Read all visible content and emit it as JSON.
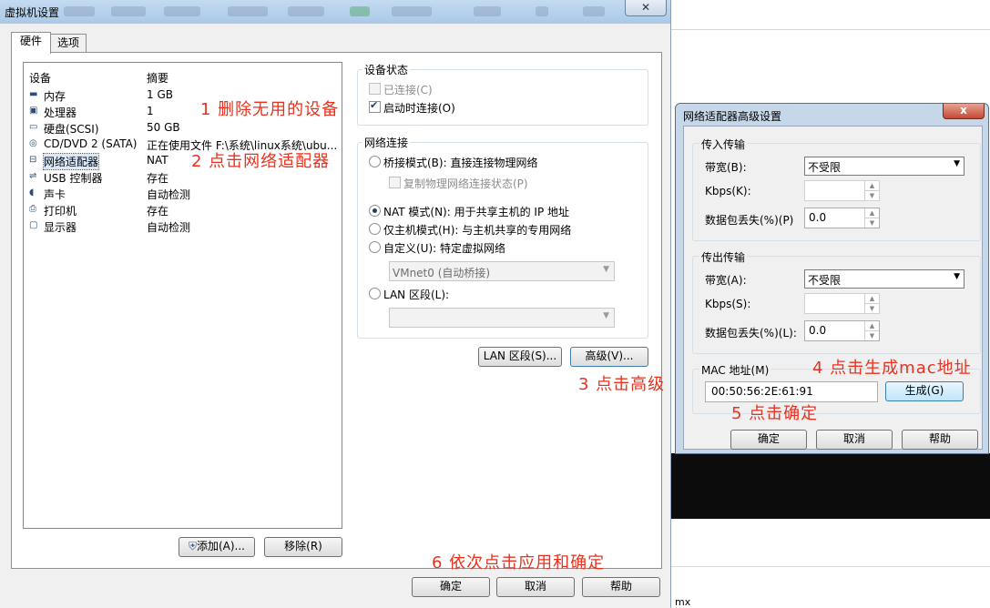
{
  "main_dialog": {
    "title": "虚拟机设置",
    "close_label": "✕",
    "tabs": [
      {
        "label": "硬件"
      },
      {
        "label": "选项"
      }
    ],
    "device_list": {
      "header_device": "设备",
      "header_summary": "摘要",
      "items": [
        {
          "name": "内存",
          "summary": "1 GB",
          "icon": "memory-icon"
        },
        {
          "name": "处理器",
          "summary": "1",
          "icon": "cpu-icon"
        },
        {
          "name": "硬盘(SCSI)",
          "summary": "50 GB",
          "icon": "harddisk-icon"
        },
        {
          "name": "CD/DVD 2 (SATA)",
          "summary": "正在使用文件 F:\\系统\\linux系统\\ubu...",
          "icon": "cd-icon"
        },
        {
          "name": "网络适配器",
          "summary": "NAT",
          "icon": "network-icon"
        },
        {
          "name": "USB 控制器",
          "summary": "存在",
          "icon": "usb-icon"
        },
        {
          "name": "声卡",
          "summary": "自动检测",
          "icon": "sound-icon"
        },
        {
          "name": "打印机",
          "summary": "存在",
          "icon": "printer-icon"
        },
        {
          "name": "显示器",
          "summary": "自动检测",
          "icon": "monitor-icon"
        }
      ]
    },
    "add_button": "添加(A)...",
    "remove_button": "移除(R)",
    "device_status": {
      "title": "设备状态",
      "connected": "已连接(C)",
      "connect_on_power": "启动时连接(O)"
    },
    "network": {
      "title": "网络连接",
      "bridged": "桥接模式(B): 直接连接物理网络",
      "replicate": "复制物理网络连接状态(P)",
      "nat": "NAT 模式(N): 用于共享主机的 IP 地址",
      "host_only": "仅主机模式(H): 与主机共享的专用网络",
      "custom": "自定义(U): 特定虚拟网络",
      "custom_select": "VMnet0 (自动桥接)",
      "lan": "LAN 区段(L):",
      "lan_select": ""
    },
    "lan_segments_button": "LAN 区段(S)...",
    "advanced_button": "高级(V)...",
    "ok_button": "确定",
    "cancel_button": "取消",
    "help_button": "帮助"
  },
  "advanced_dialog": {
    "title": "网络适配器高级设置",
    "close_label": "x",
    "incoming": {
      "title": "传入传输",
      "bandwidth_label": "带宽(B):",
      "bandwidth_value": "不受限",
      "kbps_label": "Kbps(K):",
      "kbps_value": "",
      "loss_label": "数据包丢失(%)(P)",
      "loss_value": "0.0"
    },
    "outgoing": {
      "title": "传出传输",
      "bandwidth_label": "带宽(A):",
      "bandwidth_value": "不受限",
      "kbps_label": "Kbps(S):",
      "kbps_value": "",
      "loss_label": "数据包丢失(%)(L):",
      "loss_value": "0.0"
    },
    "mac": {
      "title": "MAC 地址(M)",
      "value": "00:50:56:2E:61:91",
      "generate_button": "生成(G)"
    },
    "ok_button": "确定",
    "cancel_button": "取消",
    "help_button": "帮助"
  },
  "annotations": {
    "step1": "1 删除无用的设备",
    "step2": "2 点击网络适配器",
    "step3": "3 点击高级",
    "step4": "4 点击生成mac地址",
    "step5": "5 点击确定",
    "step6": "6 依次点击应用和确定"
  },
  "background_window": {
    "bottom_text": "mx"
  },
  "colors": {
    "annotation": "#e8321f",
    "title_bar": "#b6cfea",
    "adv_close": "#c44a32"
  }
}
